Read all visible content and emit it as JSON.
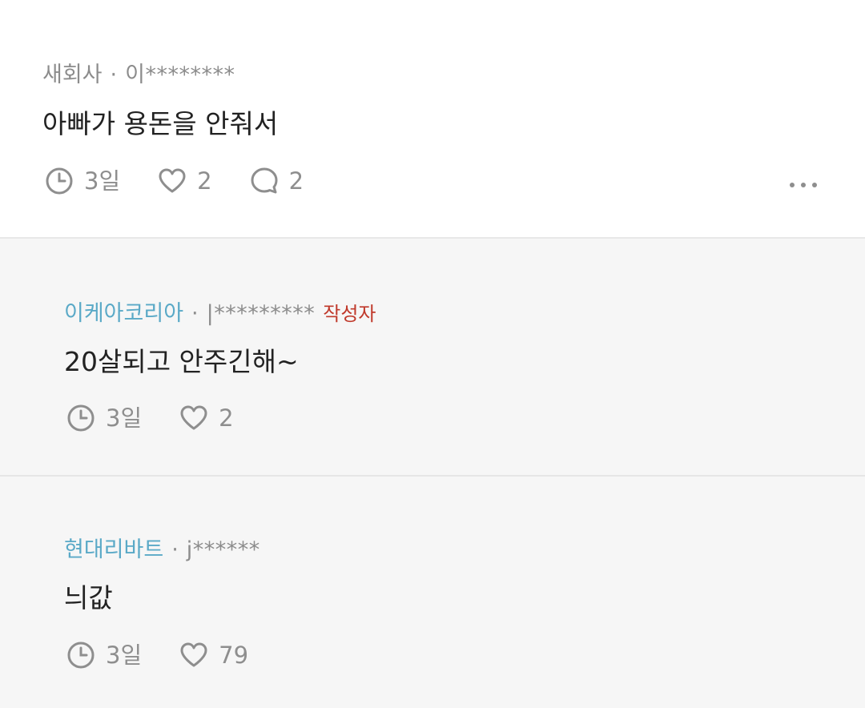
{
  "post": {
    "company": "새회사",
    "separator": "·",
    "user_id": "이********",
    "body": "아빠가 용돈을 안줘서",
    "time": "3일",
    "likes": "2",
    "comments": "2"
  },
  "replies": [
    {
      "company": "이케아코리아",
      "separator": "·",
      "user_id": "|*********",
      "badge": "작성자",
      "body": "20살되고 안주긴해~",
      "time": "3일",
      "likes": "2"
    },
    {
      "company": "현대리바트",
      "separator": "·",
      "user_id": "j******",
      "body": "늬값",
      "time": "3일",
      "likes": "79"
    }
  ],
  "colors": {
    "reply_company": "#5aa9c7",
    "author_badge": "#c0392b",
    "reply_background": "#f6f6f6"
  },
  "icons": [
    "clock-icon",
    "heart-icon",
    "comment-icon",
    "more-icon"
  ]
}
